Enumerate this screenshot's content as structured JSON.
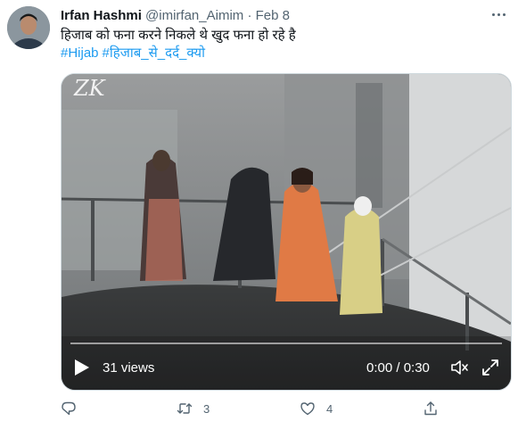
{
  "tweet": {
    "author_name": "Irfan Hashmi",
    "handle": "@imirfan_Aimim",
    "separator": "·",
    "date": "Feb 8",
    "text": "हिजाब को फना करने निकले थे खुद फना हो रहे है",
    "hashtags": [
      "#Hijab",
      "#हिजाब_से_दर्द_क्यो"
    ]
  },
  "video": {
    "watermark": "ZK",
    "views": "31 views",
    "time": "0:00 / 0:30",
    "progress": 0
  },
  "actions": {
    "reply_count": "",
    "retweet_count": "3",
    "like_count": "4"
  },
  "icons": {
    "more": "more-dots-icon",
    "play": "play-icon",
    "mute": "speaker-muted-icon",
    "expand": "expand-icon",
    "reply": "reply-icon",
    "retweet": "retweet-icon",
    "like": "heart-icon",
    "share": "share-icon"
  },
  "colors": {
    "link": "#1d9bf0",
    "muted": "#536471",
    "text": "#0f1419"
  }
}
